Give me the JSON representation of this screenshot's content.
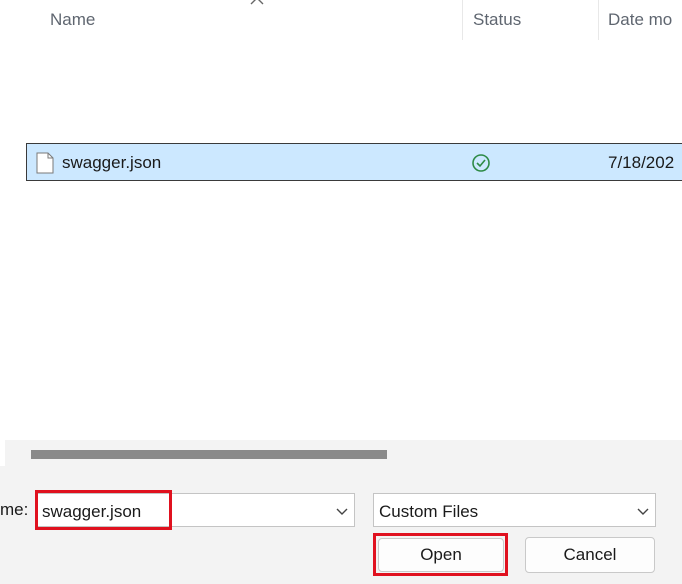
{
  "file_list": {
    "columns": {
      "name": "Name",
      "status": "Status",
      "date_modified": "Date mo"
    },
    "rows": [
      {
        "name": "swagger.json",
        "status": "synced",
        "date": "7/18/202"
      }
    ]
  },
  "footer": {
    "filename_label": "me:",
    "filename_value": "swagger.json",
    "filetype_value": "Custom Files",
    "open_label": "Open",
    "cancel_label": "Cancel"
  },
  "colors": {
    "selection": "#cce8ff",
    "highlight": "#e0111f",
    "status_ok": "#2d8a45"
  }
}
